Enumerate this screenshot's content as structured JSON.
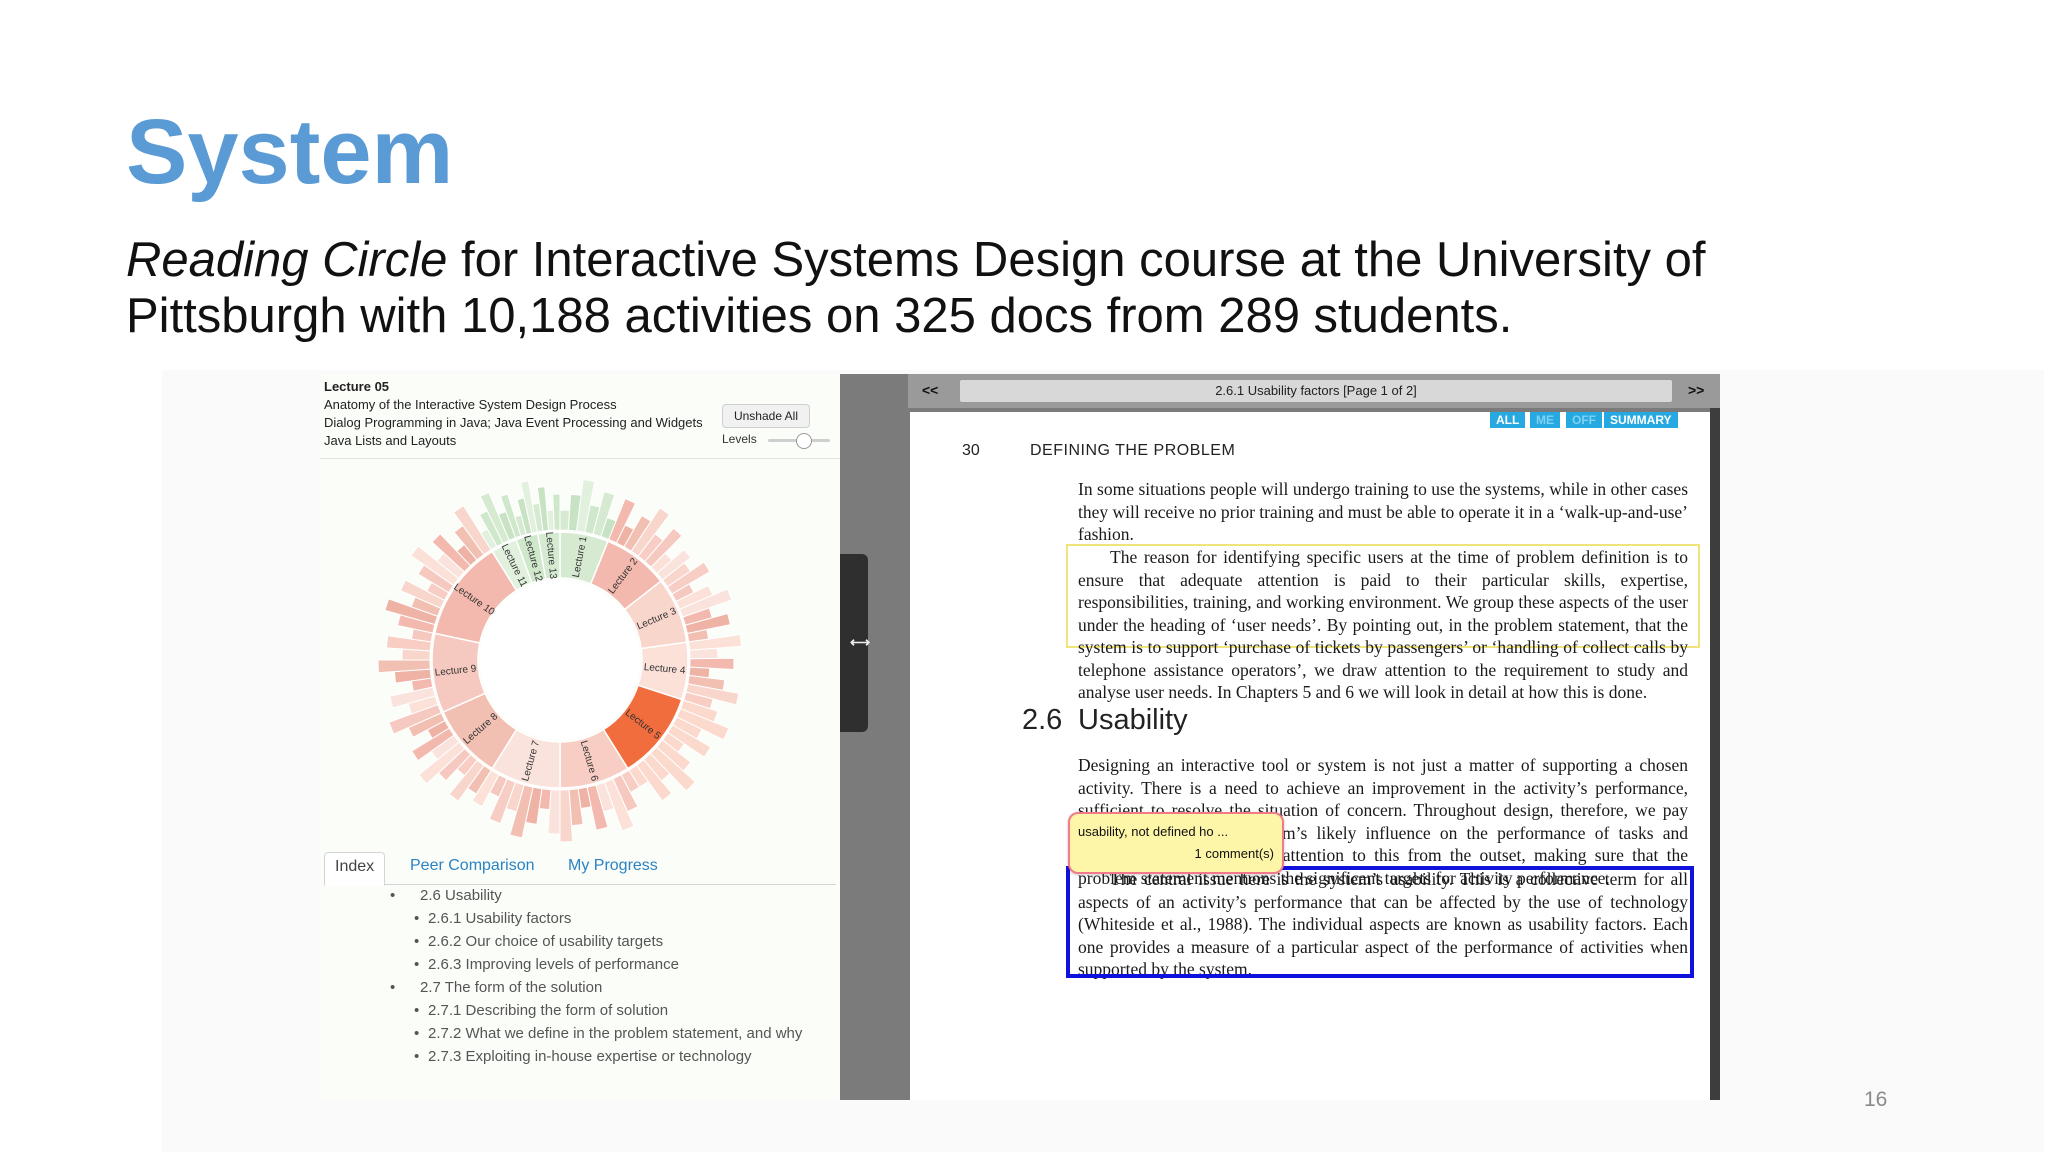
{
  "slide": {
    "title": "System",
    "subtitle_italic": "Reading Circle",
    "subtitle_rest": " for Interactive Systems Design course at the University of Pittsburgh with 10,188 activities on 325 docs from 289 students.",
    "page_number": "16"
  },
  "left_panel": {
    "header_lines": [
      "Lecture 05",
      "Anatomy of the Interactive System Design Process",
      "Dialog Programming in Java; Java Event Processing and Widgets",
      "Java Lists and Layouts"
    ],
    "unshade_label": "Unshade All",
    "levels_label": "Levels",
    "sunburst_labels": [
      "Lecture 1",
      "Lecture 2",
      "Lecture 3",
      "Lecture 4",
      "Lecture 5",
      "Lecture 6",
      "Lecture 7",
      "Lecture 8",
      "Lecture 9",
      "Lecture 10",
      "Lecture 11",
      "Lecture 12",
      "Lecture 13"
    ],
    "tabs": [
      "Index",
      "Peer Comparison",
      "My Progress"
    ],
    "index_items": [
      {
        "level": 1,
        "text": "2.6 Usability"
      },
      {
        "level": 2,
        "text": "2.6.1 Usability factors"
      },
      {
        "level": 2,
        "text": "2.6.2 Our choice of usability targets"
      },
      {
        "level": 2,
        "text": "2.6.3 Improving levels of performance"
      },
      {
        "level": 1,
        "text": "2.7 The form of the solution"
      },
      {
        "level": 2,
        "text": "2.7.1 Describing the form of solution"
      },
      {
        "level": 2,
        "text": "2.7.2 What we define in the problem statement, and why"
      },
      {
        "level": 2,
        "text": "2.7.3 Exploiting in-house expertise or technology"
      }
    ]
  },
  "viewer": {
    "prev": "<<",
    "next": ">>",
    "page_title": "2.6.1 Usability factors [Page 1 of 2]",
    "filters": [
      "ALL",
      "ME",
      "OFF",
      "SUMMARY"
    ],
    "handle_glyph": "⟷",
    "page_number": "30",
    "page_header": "DEFINING THE PROBLEM",
    "p1": "In some situations people will undergo training to use the systems, while in other cases they will receive no prior training and must be able to operate it in a ‘walk-up-and-use’ fashion.",
    "p2": "The reason for identifying specific users at the time of problem definition is to ensure that adequate attention is paid to their particular skills, expertise, responsibilities, training, and working environment. We group these aspects of the user under the heading of ‘user needs’. By pointing out, in the problem statement, that the system is to support ‘purchase of tickets by passengers’ or ‘handling of collect calls by telephone assistance operators’, we draw attention to the requirement to study and analyse user needs. In Chapters 5 and 6 we will look in detail at how this is done.",
    "section_number": "2.6",
    "section_title": "Usability",
    "p3": "Designing an interactive tool or system is not just a matter of supporting a chosen activity. There is a need to achieve an improvement in the activity’s performance, sufficient to resolve the situation of concern. Throughout design, therefore, we pay close attention to the system’s likely influence on the performance of tasks and processes. We start paying attention to this from the outset, making sure that the problem statement mentions the significant targets for activity performance.",
    "p4": "The central issue here is the system’s usability. This is a collective term for all aspects of an activity’s performance that can be affected by the use of technology (Whiteside et al., 1988). The individual aspects are known as usability factors. Each one provides a measure of a particular aspect of the performance of activities when supported by the system.",
    "comment_text": "usability, not defined ho ...",
    "comment_count": "1 comment(s)"
  },
  "colors": {
    "title": "#5b9bd5",
    "highlight_blue": "#1111dd",
    "highlight_yellow": "#f0e37a",
    "active_segment": "#f26d3d",
    "filter_tab": "#26a8e0"
  }
}
